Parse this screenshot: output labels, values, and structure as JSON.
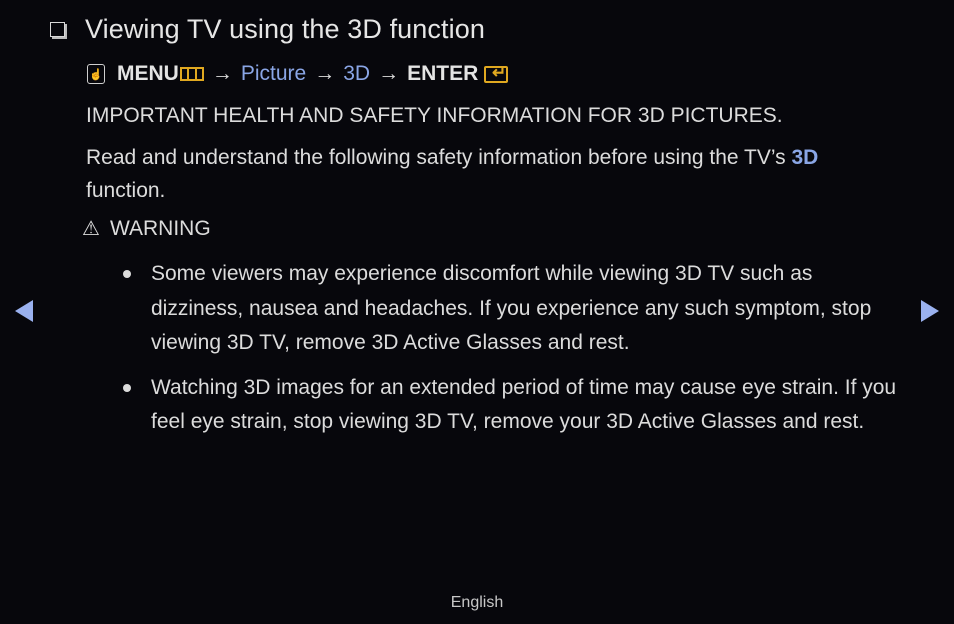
{
  "header": {
    "title": "Viewing TV using the 3D function"
  },
  "path": {
    "menu_label": "MENU",
    "arrow": "→",
    "picture_label": "Picture",
    "three_d_label": "3D",
    "enter_label": "ENTER",
    "icons": [
      "remote-touch-icon",
      "menu-icon",
      "enter-icon"
    ]
  },
  "content": {
    "important_heading": "IMPORTANT HEALTH AND SAFETY INFORMATION FOR 3D PICTURES.",
    "intro_text": "Read and understand the following safety information before using the TV’s ",
    "intro_highlight": "3D",
    "intro_tail": " function.",
    "warning_icon": "⚠",
    "warning_label": "WARNING",
    "bullets": [
      "Some viewers may experience discomfort while viewing 3D TV such as dizziness, nausea and headaches. If you experience any such symptom, stop viewing 3D TV, remove 3D Active Glasses and rest.",
      "Watching 3D images for an extended period of time may cause eye strain. If you feel eye strain, stop viewing 3D TV, remove your 3D Active Glasses and rest."
    ]
  },
  "navigation": {
    "prev_icon": "triangle-left-icon",
    "next_icon": "triangle-right-icon"
  },
  "footer": {
    "language": "English"
  },
  "colors": {
    "background": "#07070c",
    "link": "#8aa6e6",
    "icon_accent": "#e0a820",
    "nav_arrow": "#9ab1ef"
  }
}
